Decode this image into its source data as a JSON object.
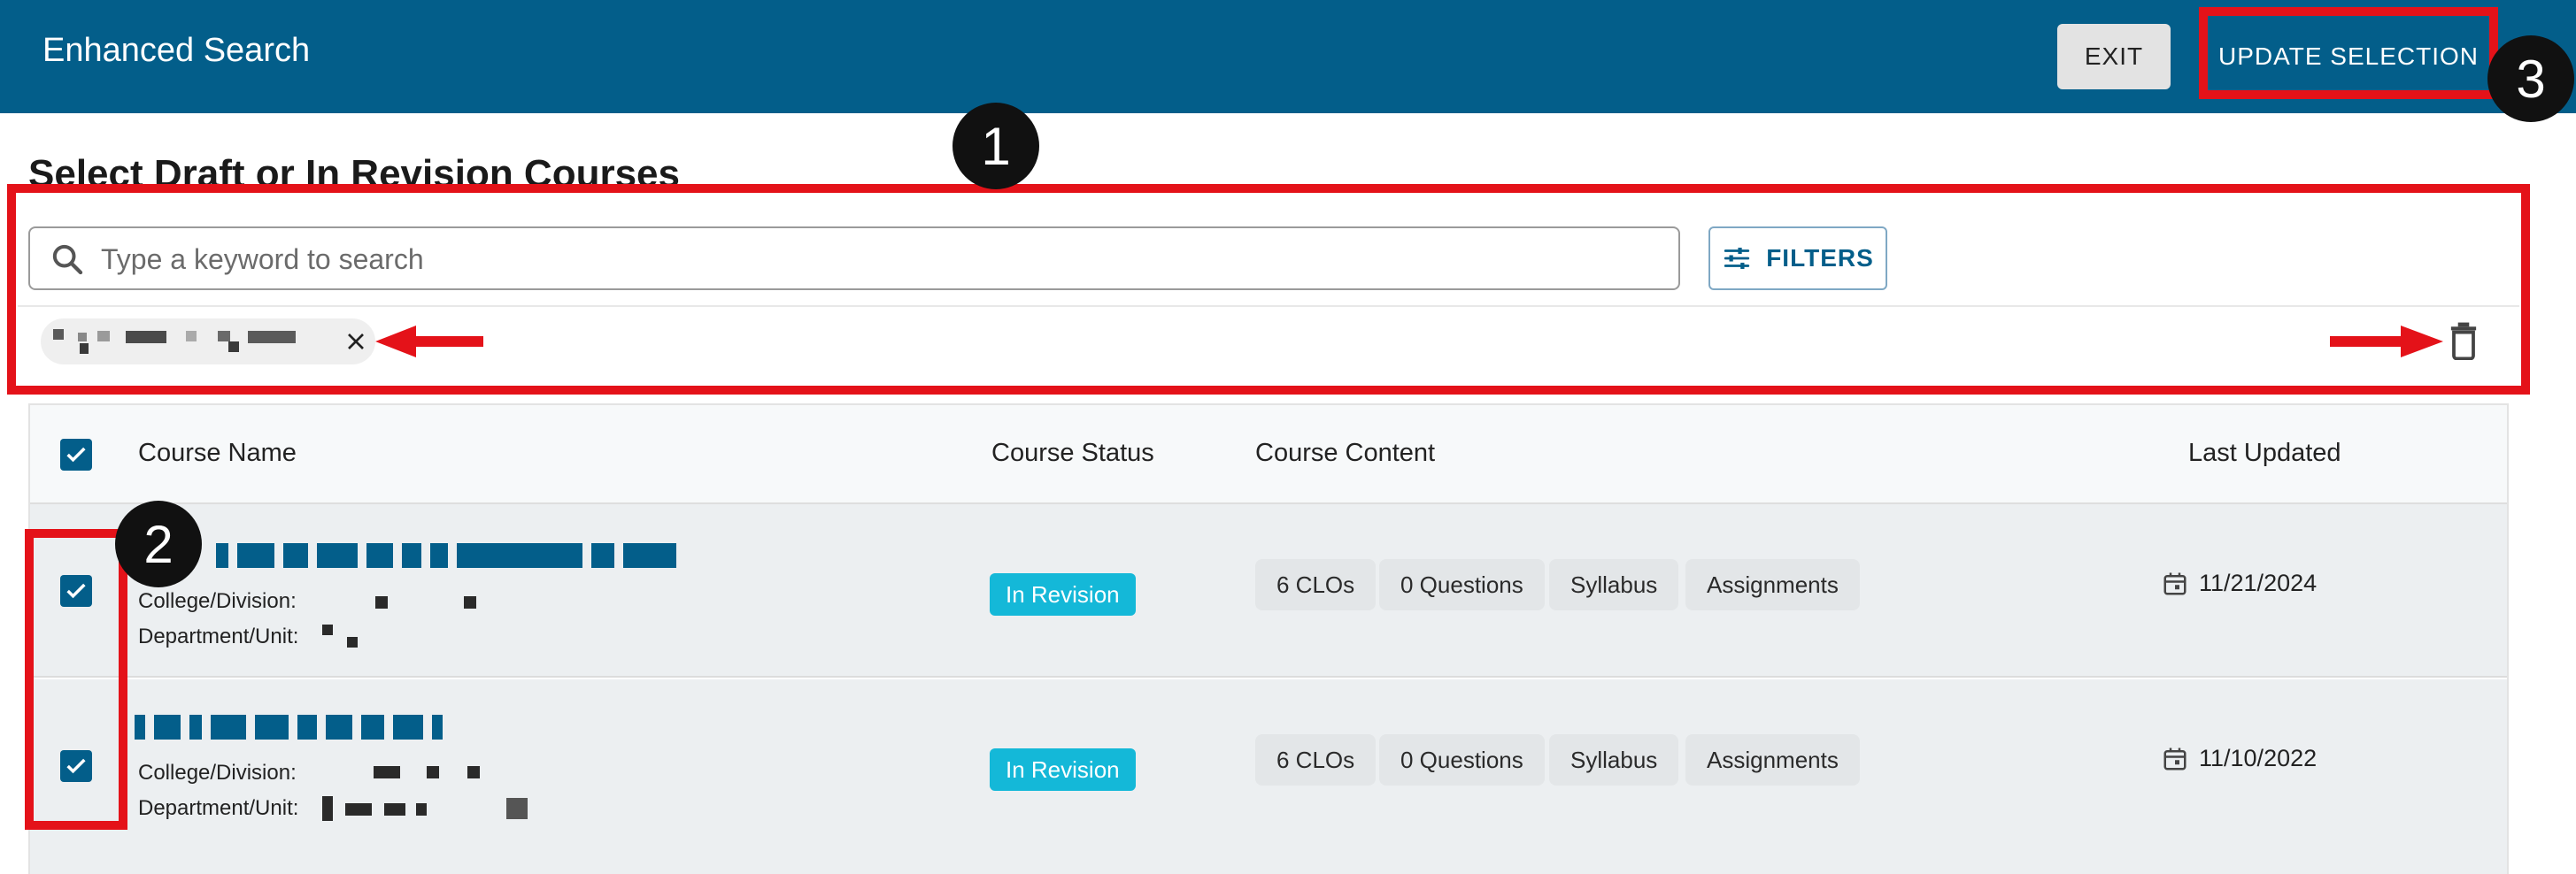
{
  "header": {
    "title": "Enhanced Search",
    "exit_label": "EXIT",
    "update_label": "UPDATE SELECTION"
  },
  "page": {
    "heading": "Select Draft or In Revision Courses"
  },
  "search": {
    "placeholder": "Type a keyword to search",
    "value": "",
    "filters_label": "FILTERS"
  },
  "table": {
    "columns": [
      "Course Name",
      "Course Status",
      "Course Content",
      "Last Updated"
    ],
    "rows": [
      {
        "checked": true,
        "college_label": "College/Division:",
        "department_label": "Department/Unit:",
        "status": "In Revision",
        "content": [
          "6 CLOs",
          "0 Questions",
          "Syllabus",
          "Assignments"
        ],
        "last_updated": "11/21/2024"
      },
      {
        "checked": true,
        "college_label": "College/Division:",
        "department_label": "Department/Unit:",
        "status": "In Revision",
        "content": [
          "6 CLOs",
          "0 Questions",
          "Syllabus",
          "Assignments"
        ],
        "last_updated": "11/10/2022"
      }
    ]
  },
  "annotations": {
    "badge1": "1",
    "badge2": "2",
    "badge3": "3"
  },
  "colors": {
    "header": "#035E8A",
    "annotation": "#E41219",
    "status": "#14B8D8"
  }
}
